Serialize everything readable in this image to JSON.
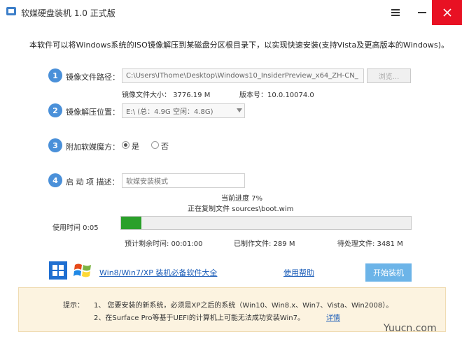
{
  "window": {
    "title": "软媒硬盘装机 1.0 正式版"
  },
  "description": "本软件可以将Windows系统的ISO镜像解压到某磁盘分区根目录下，以实现快速安装(支持Vista及更高版本的Windows)。",
  "steps": [
    {
      "num": "1",
      "label": "镜像文件路径：",
      "value": "C:\\Users\\IThome\\Desktop\\Windows10_InsiderPreview_x64_ZH-CN_",
      "button": "浏览..."
    },
    {
      "num": "2",
      "label": "镜像解压位置：",
      "value": "E:\\ (总：4.9G 空闲：4.8G)"
    },
    {
      "num": "3",
      "label": "附加软媒魔方：",
      "options": [
        "是",
        "否"
      ],
      "selected": "是"
    },
    {
      "num": "4",
      "label": "启 动 项 描述：",
      "value": "软媒安装模式"
    }
  ],
  "image_info": {
    "size": "镜像文件大小：   3776.19 M",
    "version": "版本号：10.0.10074.0"
  },
  "progress": {
    "current": "当前进度 7%",
    "file": "正在复制文件 sources\\boot.wim",
    "percent": 7,
    "elapsed": "使用时间 0:05",
    "remaining": "预计剩余时间: 00:01:00",
    "done_files": "已制作文件: 289 M",
    "pending_files": "待处理文件: 3481 M"
  },
  "links": {
    "software": "Win8/Win7/XP 装机必备软件大全",
    "help": "使用帮助"
  },
  "start_button": "开始装机",
  "tips": {
    "label": "提示：",
    "line1": "1、 您要安装的新系统，必须是XP之后的系统（Win10、Win8.x、Win7、Vista、Win2008）。",
    "line2": "2、在Surface Pro等基于UEFI的计算机上可能无法成功安装Win7。",
    "detail_link": "详情"
  },
  "watermark": "Yuucn.com",
  "colors": {
    "accent": "#4a90d9",
    "progress": "#2aa02a",
    "close": "#e81123",
    "start": "#6cb4e8",
    "tip_bg": "#fcf3e0"
  },
  "icons": [
    "app-icon",
    "menu-icon",
    "minimize-icon",
    "close-icon",
    "windows8-logo-icon",
    "windows7-logo-icon",
    "dropdown-arrow-icon"
  ]
}
